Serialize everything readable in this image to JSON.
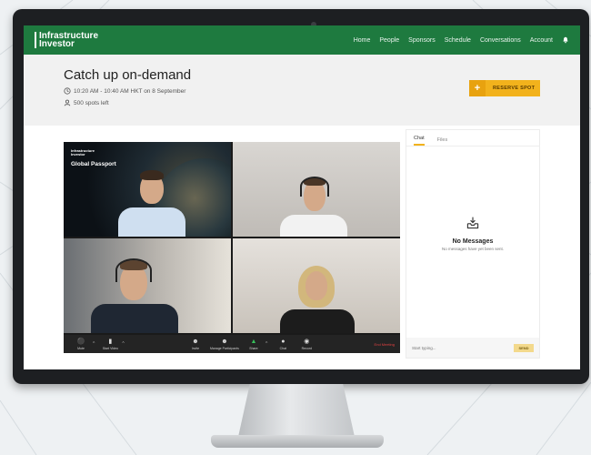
{
  "nav": {
    "logo_line1": "Infrastructure",
    "logo_line2": "Investor",
    "links": [
      "Home",
      "People",
      "Sponsors",
      "Schedule",
      "Conversations",
      "Account"
    ]
  },
  "event": {
    "title": "Catch up on-demand",
    "time": "10:20 AM - 10:40 AM HKT on 8 September",
    "spots": "500 spots left",
    "reserve_label": "RESERVE SPOT"
  },
  "video": {
    "brand_small_line1": "Infrastructure",
    "brand_small_line2": "Investor",
    "brand_big": "Global Passport",
    "toolbar": {
      "mute": "Mute",
      "start_video": "Start Video",
      "invite": "Invite",
      "manage_participants": "Manage Participants",
      "share": "Share",
      "chat": "Chat",
      "record": "Record",
      "end_meeting": "End Meeting"
    }
  },
  "chat": {
    "tabs": [
      "Chat",
      "Files"
    ],
    "empty_title": "No Messages",
    "empty_subtitle": "No messages have yet been sent.",
    "input_placeholder": "Start typing...",
    "send_label": "SEND"
  },
  "colors": {
    "brand_green": "#1e7a3f",
    "accent_yellow": "#f2b21c"
  }
}
